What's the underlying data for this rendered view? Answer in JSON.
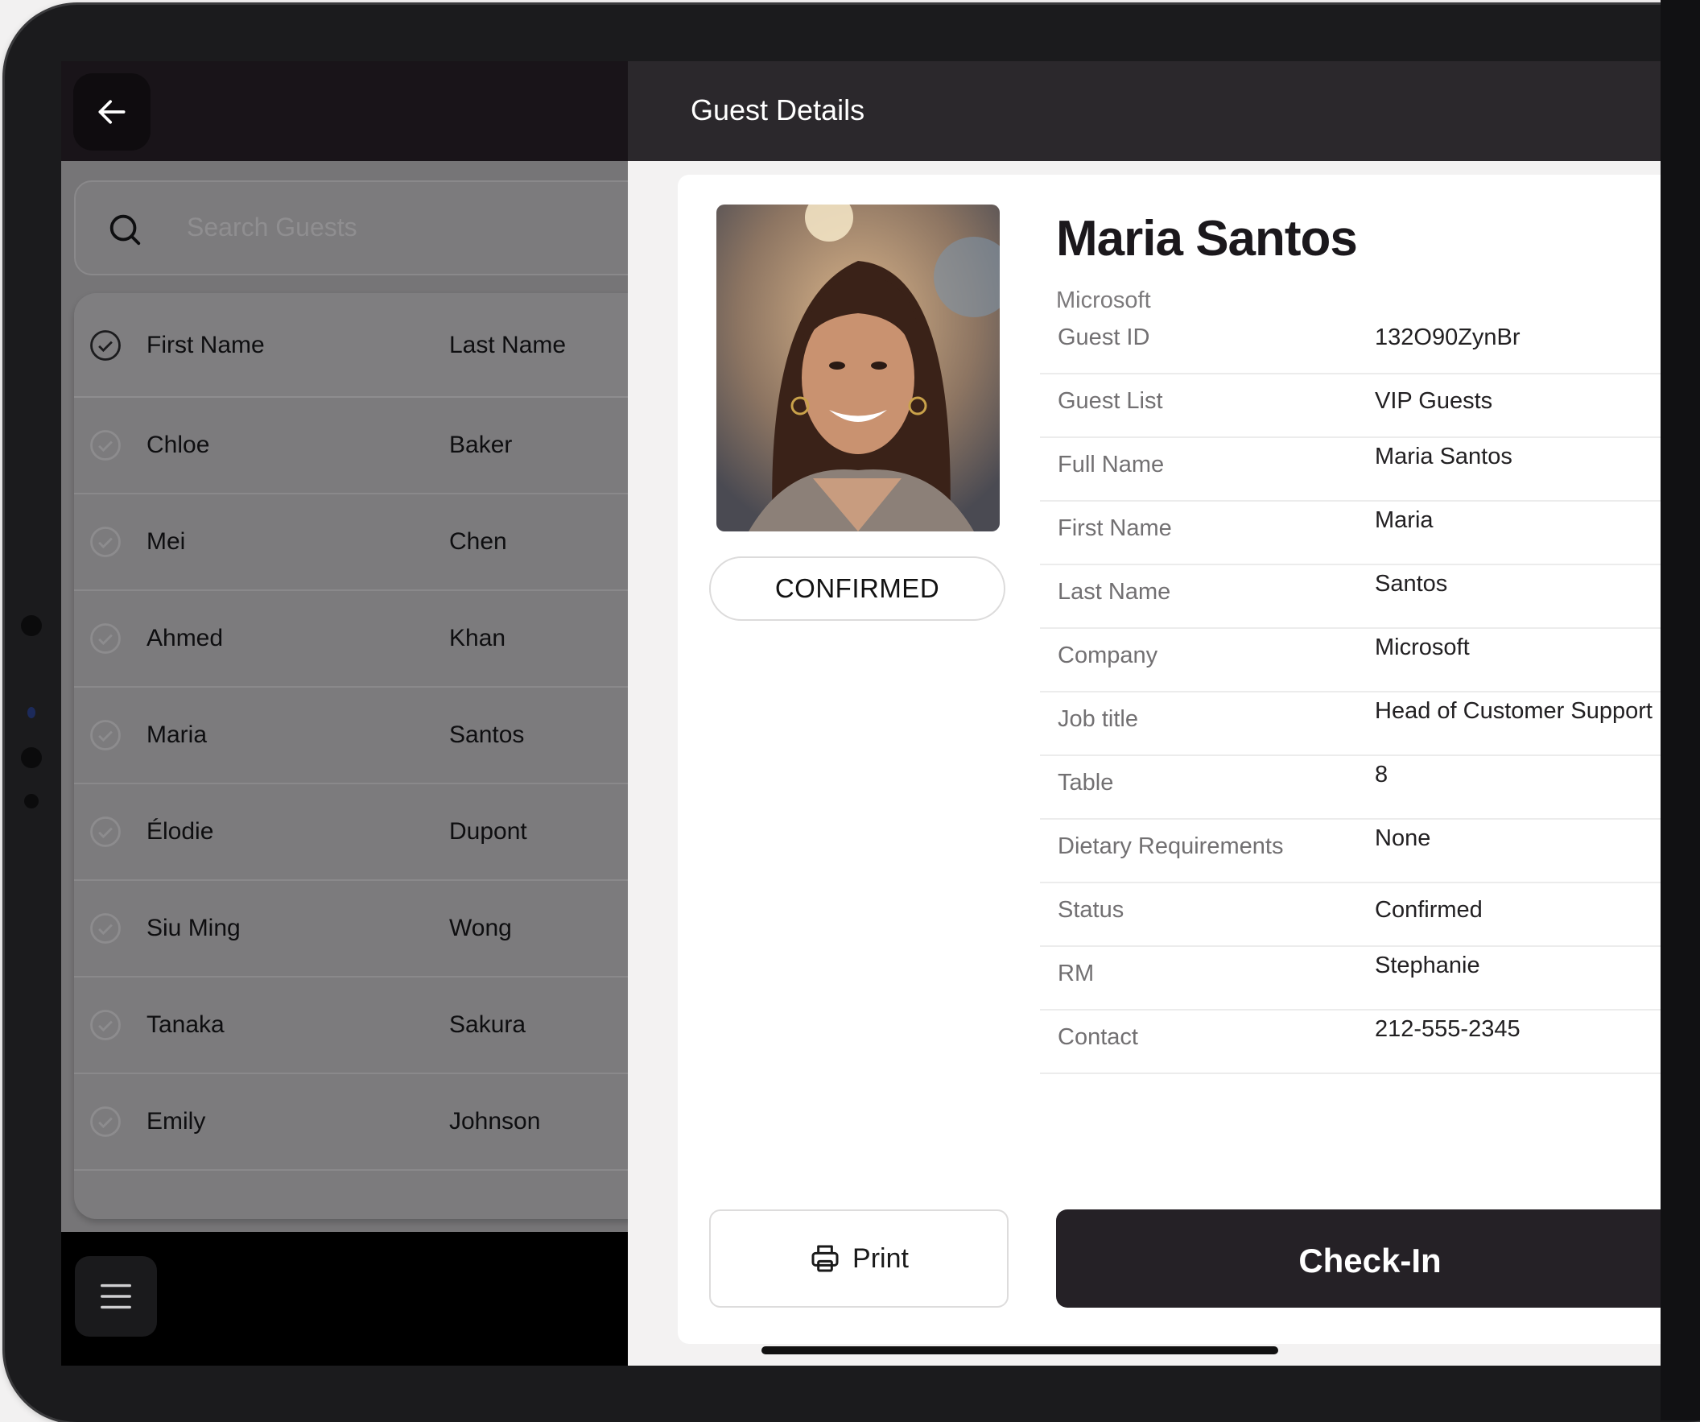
{
  "header": {
    "title": "Guest Details"
  },
  "search": {
    "placeholder": "Search Guests"
  },
  "guest_table": {
    "columns": [
      "First Name",
      "Last Name"
    ],
    "rows": [
      {
        "first": "Chloe",
        "last": "Baker"
      },
      {
        "first": "Mei",
        "last": "Chen"
      },
      {
        "first": "Ahmed",
        "last": "Khan"
      },
      {
        "first": "Maria",
        "last": "Santos"
      },
      {
        "first": "Élodie",
        "last": "Dupont"
      },
      {
        "first": "Siu Ming",
        "last": "Wong"
      },
      {
        "first": "Tanaka",
        "last": "Sakura"
      },
      {
        "first": "Emily",
        "last": "Johnson"
      }
    ]
  },
  "guest": {
    "name": "Maria Santos",
    "company": "Microsoft",
    "status_badge": "CONFIRMED",
    "details": [
      {
        "label": "Guest ID",
        "value": "132O90ZynBr"
      },
      {
        "label": "Guest List",
        "value": "VIP Guests"
      },
      {
        "label": "Full Name",
        "value": "Maria Santos"
      },
      {
        "label": "First Name",
        "value": "Maria"
      },
      {
        "label": "Last Name",
        "value": "Santos"
      },
      {
        "label": "Company",
        "value": "Microsoft"
      },
      {
        "label": "Job title",
        "value": "Head of Customer Support"
      },
      {
        "label": "Table",
        "value": "8"
      },
      {
        "label": "Dietary Requirements",
        "value": "None"
      },
      {
        "label": "Status",
        "value": "Confirmed"
      },
      {
        "label": "RM",
        "value": "Stephanie"
      },
      {
        "label": "Contact",
        "value": "212-555-2345"
      }
    ]
  },
  "actions": {
    "print": "Print",
    "checkin": "Check-In"
  },
  "icons": {
    "back": "arrow-left-icon",
    "search": "search-icon",
    "menu": "hamburger-menu-icon",
    "print": "printer-icon",
    "check": "check-circle-icon"
  },
  "colors": {
    "header_dark": "#2b282c",
    "checkin_button": "#252126",
    "overlay": "#767577"
  }
}
